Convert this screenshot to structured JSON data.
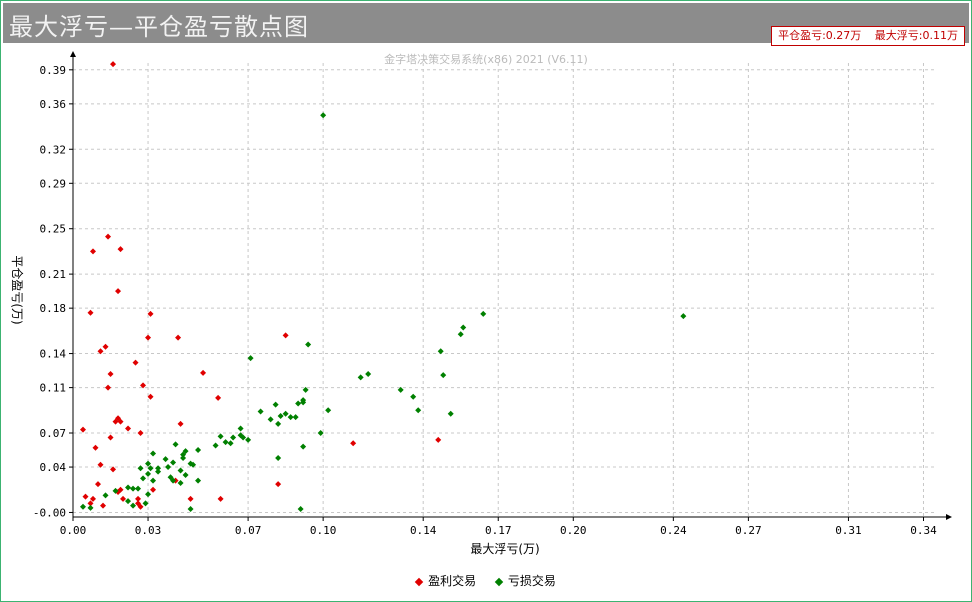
{
  "header": {
    "title": "最大浮亏—平仓盈亏散点图",
    "stat_close": "平仓盈亏:0.27万",
    "stat_float": "最大浮亏:0.11万"
  },
  "subtitle": "金字塔决策交易系统(x86) 2021 (V6.11)",
  "colors": {
    "profit": "#e00000",
    "loss": "#008000",
    "grid": "#c8c8c8",
    "titlebar": "#8c8c8c"
  },
  "chart_data": {
    "type": "scatter",
    "xlabel": "最大浮亏(万)",
    "ylabel": "平仓盈亏(万)",
    "xlim": [
      0,
      0.345
    ],
    "ylim": [
      -0.004,
      0.396
    ],
    "x_ticks": [
      "0.00",
      "0.03",
      "0.07",
      "0.10",
      "0.14",
      "0.17",
      "0.20",
      "0.24",
      "0.27",
      "0.31",
      "0.34"
    ],
    "y_ticks": [
      "-0.00",
      "0.04",
      "0.07",
      "0.11",
      "0.14",
      "0.18",
      "0.21",
      "0.25",
      "0.29",
      "0.32",
      "0.36",
      "0.39"
    ],
    "grid": true,
    "legend_position": "bottom",
    "series": [
      {
        "name": "盈利交易",
        "color": "#e00000",
        "points": [
          [
            0.016,
            0.395
          ],
          [
            0.014,
            0.243
          ],
          [
            0.019,
            0.232
          ],
          [
            0.008,
            0.23
          ],
          [
            0.018,
            0.195
          ],
          [
            0.007,
            0.176
          ],
          [
            0.031,
            0.175
          ],
          [
            0.013,
            0.146
          ],
          [
            0.011,
            0.142
          ],
          [
            0.085,
            0.156
          ],
          [
            0.03,
            0.154
          ],
          [
            0.042,
            0.154
          ],
          [
            0.025,
            0.132
          ],
          [
            0.015,
            0.122
          ],
          [
            0.052,
            0.123
          ],
          [
            0.014,
            0.11
          ],
          [
            0.028,
            0.112
          ],
          [
            0.031,
            0.102
          ],
          [
            0.058,
            0.101
          ],
          [
            0.018,
            0.083
          ],
          [
            0.017,
            0.08
          ],
          [
            0.019,
            0.08
          ],
          [
            0.043,
            0.078
          ],
          [
            0.004,
            0.073
          ],
          [
            0.022,
            0.074
          ],
          [
            0.027,
            0.07
          ],
          [
            0.015,
            0.066
          ],
          [
            0.009,
            0.057
          ],
          [
            0.112,
            0.061
          ],
          [
            0.146,
            0.064
          ],
          [
            0.016,
            0.038
          ],
          [
            0.011,
            0.042
          ],
          [
            0.01,
            0.025
          ],
          [
            0.018,
            0.018
          ],
          [
            0.02,
            0.012
          ],
          [
            0.005,
            0.014
          ],
          [
            0.008,
            0.012
          ],
          [
            0.026,
            0.012
          ],
          [
            0.026,
            0.008
          ],
          [
            0.027,
            0.005
          ],
          [
            0.032,
            0.02
          ],
          [
            0.041,
            0.028
          ],
          [
            0.047,
            0.012
          ],
          [
            0.059,
            0.012
          ],
          [
            0.082,
            0.025
          ],
          [
            0.012,
            0.006
          ],
          [
            0.007,
            0.008
          ],
          [
            0.019,
            0.02
          ]
        ]
      },
      {
        "name": "亏损交易",
        "color": "#008000",
        "points": [
          [
            0.1,
            0.35
          ],
          [
            0.244,
            0.173
          ],
          [
            0.164,
            0.175
          ],
          [
            0.156,
            0.163
          ],
          [
            0.155,
            0.157
          ],
          [
            0.094,
            0.148
          ],
          [
            0.071,
            0.136
          ],
          [
            0.147,
            0.142
          ],
          [
            0.148,
            0.121
          ],
          [
            0.118,
            0.122
          ],
          [
            0.115,
            0.119
          ],
          [
            0.131,
            0.108
          ],
          [
            0.093,
            0.108
          ],
          [
            0.136,
            0.102
          ],
          [
            0.092,
            0.099
          ],
          [
            0.092,
            0.097
          ],
          [
            0.09,
            0.096
          ],
          [
            0.081,
            0.095
          ],
          [
            0.138,
            0.09
          ],
          [
            0.151,
            0.087
          ],
          [
            0.102,
            0.09
          ],
          [
            0.085,
            0.087
          ],
          [
            0.089,
            0.084
          ],
          [
            0.083,
            0.085
          ],
          [
            0.087,
            0.084
          ],
          [
            0.075,
            0.089
          ],
          [
            0.079,
            0.082
          ],
          [
            0.082,
            0.078
          ],
          [
            0.067,
            0.074
          ],
          [
            0.099,
            0.07
          ],
          [
            0.067,
            0.068
          ],
          [
            0.068,
            0.066
          ],
          [
            0.07,
            0.064
          ],
          [
            0.064,
            0.066
          ],
          [
            0.059,
            0.067
          ],
          [
            0.061,
            0.062
          ],
          [
            0.063,
            0.061
          ],
          [
            0.057,
            0.059
          ],
          [
            0.092,
            0.058
          ],
          [
            0.05,
            0.055
          ],
          [
            0.041,
            0.06
          ],
          [
            0.045,
            0.054
          ],
          [
            0.044,
            0.051
          ],
          [
            0.044,
            0.048
          ],
          [
            0.032,
            0.052
          ],
          [
            0.037,
            0.047
          ],
          [
            0.082,
            0.048
          ],
          [
            0.04,
            0.044
          ],
          [
            0.047,
            0.043
          ],
          [
            0.048,
            0.042
          ],
          [
            0.03,
            0.043
          ],
          [
            0.031,
            0.039
          ],
          [
            0.034,
            0.039
          ],
          [
            0.038,
            0.04
          ],
          [
            0.043,
            0.037
          ],
          [
            0.027,
            0.039
          ],
          [
            0.03,
            0.034
          ],
          [
            0.034,
            0.036
          ],
          [
            0.045,
            0.033
          ],
          [
            0.028,
            0.03
          ],
          [
            0.032,
            0.028
          ],
          [
            0.039,
            0.031
          ],
          [
            0.04,
            0.028
          ],
          [
            0.043,
            0.026
          ],
          [
            0.05,
            0.028
          ],
          [
            0.022,
            0.022
          ],
          [
            0.024,
            0.021
          ],
          [
            0.026,
            0.021
          ],
          [
            0.03,
            0.016
          ],
          [
            0.017,
            0.019
          ],
          [
            0.029,
            0.008
          ],
          [
            0.022,
            0.01
          ],
          [
            0.013,
            0.015
          ],
          [
            0.004,
            0.005
          ],
          [
            0.007,
            0.004
          ],
          [
            0.024,
            0.006
          ],
          [
            0.047,
            0.003
          ],
          [
            0.091,
            0.003
          ]
        ]
      }
    ]
  },
  "legend": {
    "profit_label": "盈利交易",
    "loss_label": "亏损交易"
  }
}
